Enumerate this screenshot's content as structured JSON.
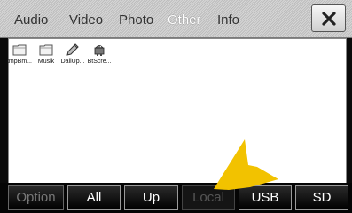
{
  "tabs": [
    {
      "label": "Audio"
    },
    {
      "label": "Video"
    },
    {
      "label": "Photo"
    },
    {
      "label": "Other"
    },
    {
      "label": "Info"
    }
  ],
  "files": [
    {
      "label": "tmpBm...",
      "icon": "folder-icon"
    },
    {
      "label": "Musik",
      "icon": "folder-icon"
    },
    {
      "label": "DailUp...",
      "icon": "pen-file-icon"
    },
    {
      "label": "BtScre...",
      "icon": "android-file-icon"
    }
  ],
  "bottom": {
    "option": "Option",
    "all": "All",
    "up": "Up",
    "local": "Local",
    "usb": "USB",
    "sd": "SD"
  },
  "colors": {
    "accent_arrow": "#f2c200"
  }
}
